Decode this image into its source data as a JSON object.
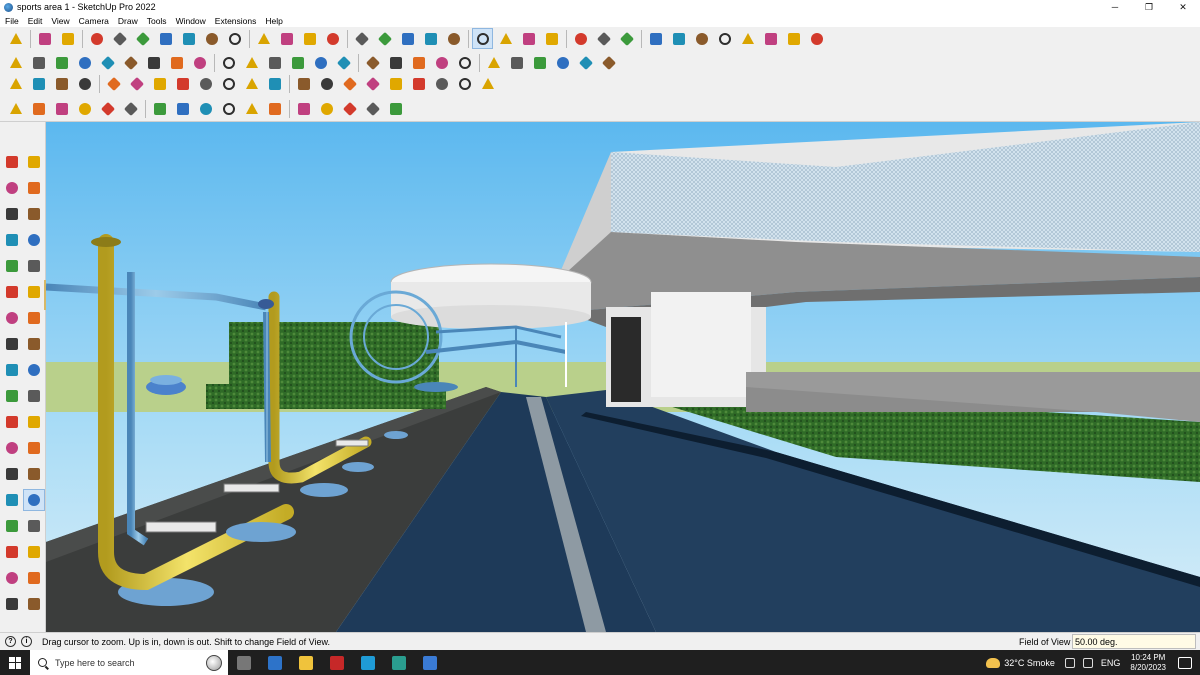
{
  "window": {
    "title": "sports area 1 - SketchUp Pro 2022",
    "minimize": "─",
    "maximize": "❐",
    "close": "✕"
  },
  "menu": [
    "File",
    "Edit",
    "View",
    "Camera",
    "Draw",
    "Tools",
    "Window",
    "Extensions",
    "Help"
  ],
  "toolbars": {
    "row1": [
      "zoom-icon",
      "select-icon",
      "eraser-icon",
      "line-icon",
      "arc-icon",
      "rectangle-icon",
      "push-pull-icon",
      "move-icon",
      "rotate-icon",
      "scale-icon",
      "offset-icon",
      "tape-measure-icon",
      "text-icon",
      "axes-icon",
      "paint-bucket-icon",
      "orbit-icon",
      "pan-icon",
      "zoom-tool-icon",
      "zoom-extents-icon",
      "component-icon",
      "layers-icon",
      "walk-icon",
      "look-around-icon",
      "position-camera-icon",
      "section-plane-icon",
      "views-icon",
      "iso-view-icon",
      "top-view-icon",
      "front-view-icon",
      "right-view-icon",
      "back-view-icon",
      "left-view-icon",
      "undo-icon",
      "redo-icon"
    ],
    "row2": [
      "iso-box-icon",
      "xray-icon",
      "back-edges-icon",
      "wireframe-icon",
      "hidden-line-icon",
      "shaded-icon",
      "textured-icon",
      "monochrome-icon",
      "sandbox-icon",
      "smoove-icon",
      "stamp-icon",
      "drape-icon",
      "add-detail-icon",
      "flip-edge-icon",
      "warehouse-icon",
      "extension-icon",
      "styles-icon",
      "shadows-icon",
      "fog-icon",
      "soften-icon",
      "solid-union-icon",
      "solid-subtract-icon",
      "solid-trim-icon",
      "solid-intersect-icon",
      "outer-shell-icon",
      "split-icon"
    ],
    "row3": [
      "component-small-icon",
      "group-icon",
      "dimension-icon",
      "protractor-icon",
      "circle-tool-icon",
      "polygon-icon",
      "freehand-icon",
      "follow-me-icon",
      "intersect-icon",
      "explode-icon",
      "lock-icon",
      "hide-icon",
      "unhide-icon",
      "scene-icon",
      "match-photo-icon",
      "geo-location-icon",
      "terrain-icon",
      "curic-icon",
      "fredo-icon",
      "joint-push-pull-icon",
      "round-corner-icon"
    ],
    "row4": [
      "orbit-small-icon",
      "bezier-icon",
      "spline-icon",
      "extrude-icon",
      "loft-icon",
      "skin-icon",
      "lathe-icon",
      "tube-icon",
      "hatch-icon",
      "array-icon",
      "align-icon",
      "mirror-icon",
      "label-icon",
      "profile-icon",
      "weld-icon",
      "chamfer-icon",
      "fillet-icon"
    ]
  },
  "left_toolbar": [
    "select-arrow-icon",
    "make-component-icon",
    "paint-bucket-left-icon",
    "eraser-left-icon",
    "tag-icon",
    "line-left-icon",
    "freehand-left-icon",
    "rectangle-left-icon",
    "rotated-rect-icon",
    "circle-left-icon",
    "polygon-left-icon",
    "arc-left-icon",
    "pie-icon",
    "move-left-icon",
    "push-pull-left-icon",
    "rotate-left-icon",
    "follow-me-left-icon",
    "scale-left-icon",
    "offset-left-icon",
    "tape-left-icon",
    "dimension-left-icon",
    "protractor-left-icon",
    "text-left-icon",
    "axes-left-icon",
    "3d-text-icon",
    "orbit-left-icon",
    "pan-left-icon",
    "zoom-left-icon",
    "zoom-window-icon",
    "zoom-extents-left-icon",
    "prev-view-icon",
    "position-camera-left-icon",
    "look-around-left-icon",
    "walk-left-icon",
    "section-left-icon",
    "section-display-icon"
  ],
  "status": {
    "message": "Drag cursor to zoom.  Up is in, down is out. Shift to change Field of View.",
    "vcb_label": "Field of View",
    "vcb_value": "50.00 deg."
  },
  "taskbar": {
    "search_placeholder": "Type here to search",
    "apps": [
      "task-view-icon",
      "calculator-icon",
      "file-explorer-icon",
      "acrobat-icon",
      "mail-icon",
      "edge-icon",
      "sketchup-icon"
    ],
    "weather": "32°C  Smoke",
    "lang": "ENG",
    "time": "10:24 PM",
    "date": "8/20/2023"
  }
}
